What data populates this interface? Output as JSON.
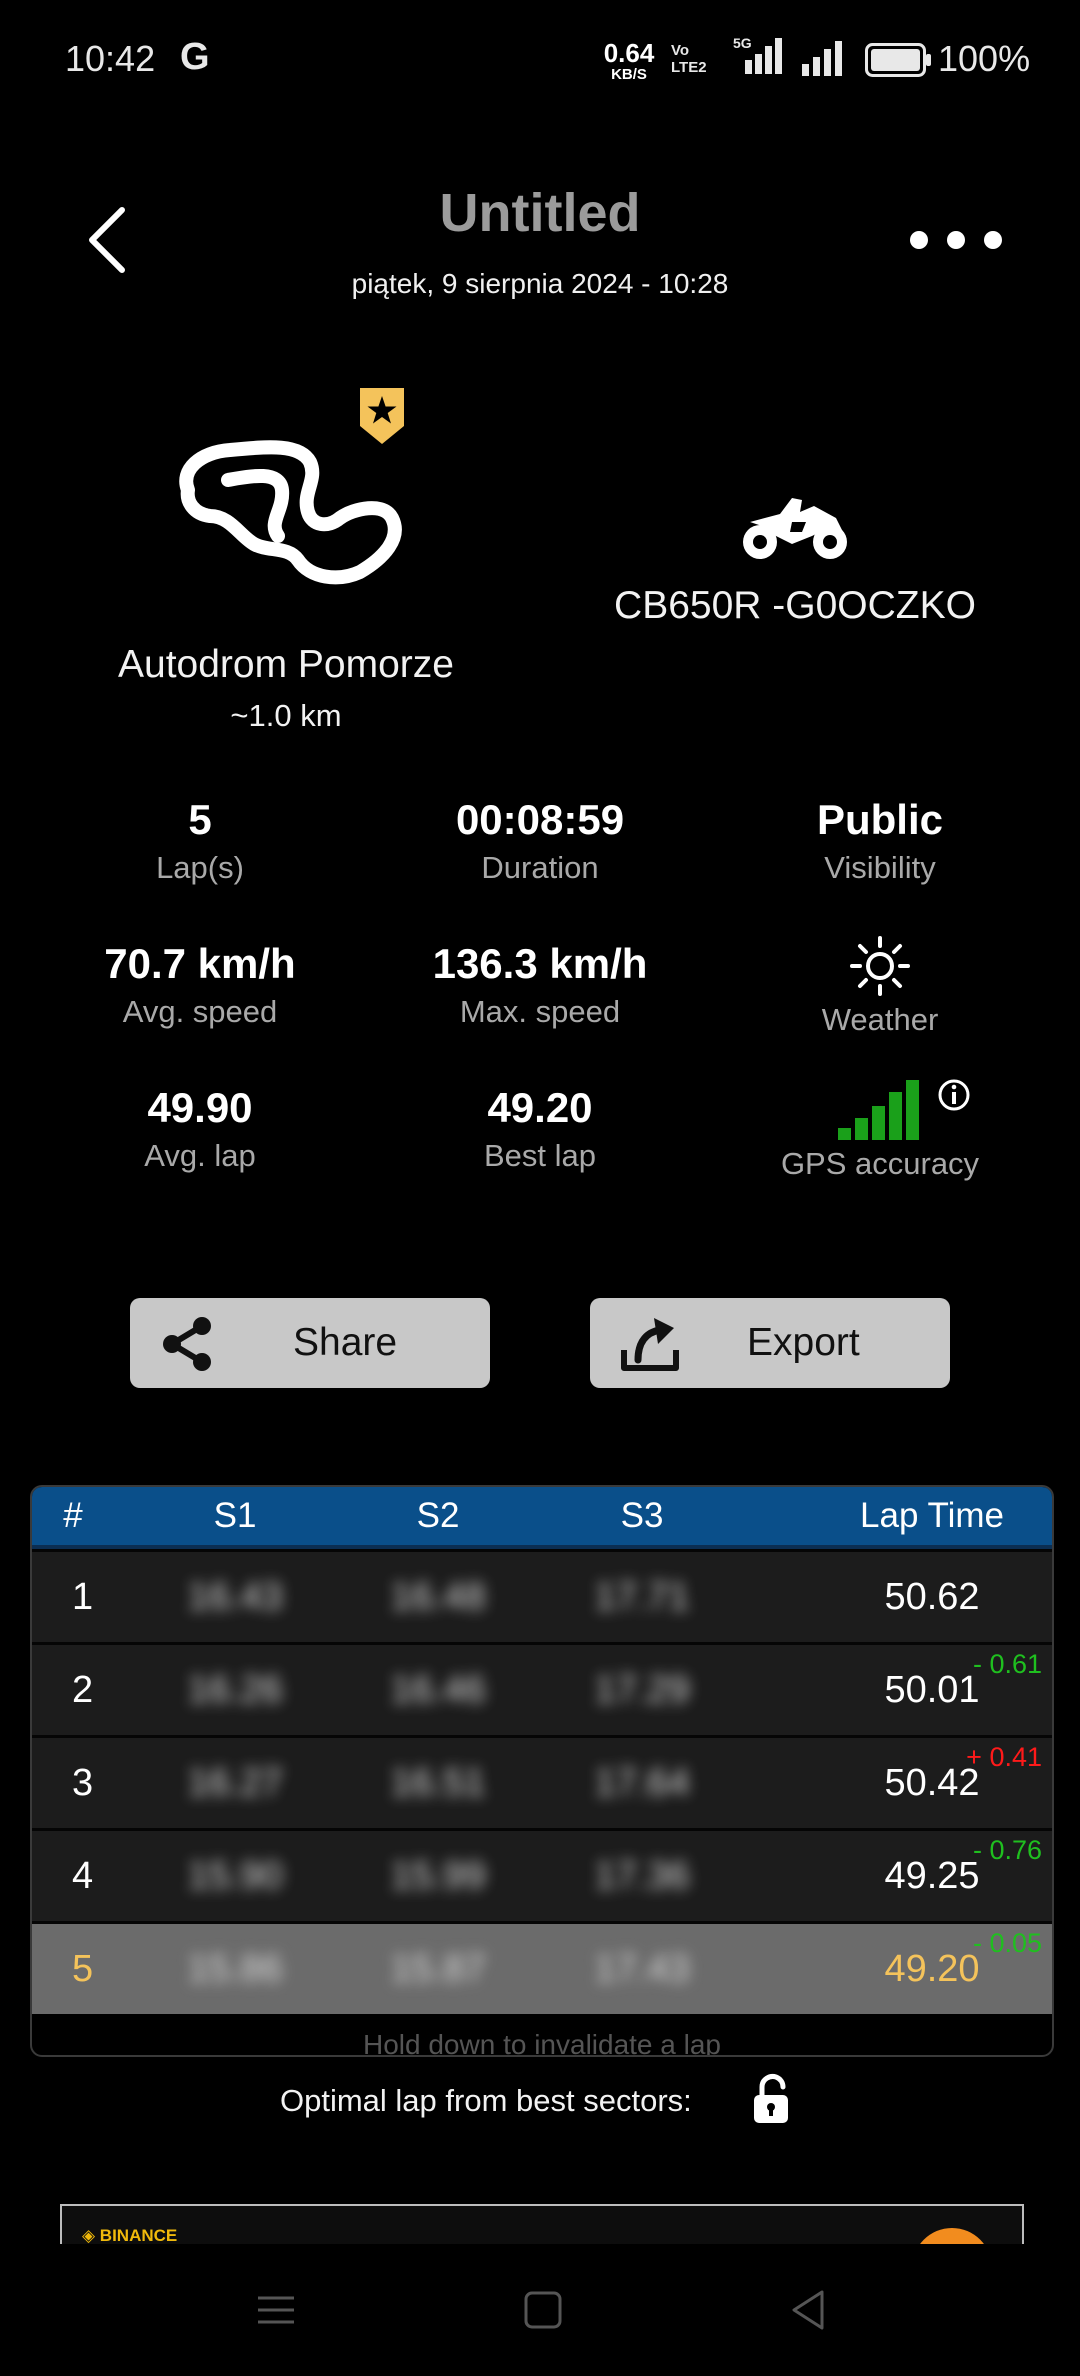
{
  "status_bar": {
    "time": "10:42",
    "g_logo": "G",
    "speed_value": "0.64",
    "speed_unit": "KB/S",
    "volte": "Vo LTE2",
    "network": "5G",
    "battery": "100%"
  },
  "header": {
    "title": "Untitled",
    "subtitle": "piątek, 9 sierpnia 2024  -  10:28"
  },
  "track": {
    "name": "Autodrom Pomorze",
    "length": "~1.0 km",
    "badge_icon": "star-badge-icon"
  },
  "bike": {
    "name": "CB650R -G0OCZKO",
    "icon": "motorcycle-icon"
  },
  "stats": {
    "laps": {
      "value": "5",
      "label": "Lap(s)"
    },
    "duration": {
      "value": "00:08:59",
      "label": "Duration"
    },
    "visibility": {
      "value": "Public",
      "label": "Visibility"
    },
    "avg_speed": {
      "value": "70.7 km/h",
      "label": "Avg. speed"
    },
    "max_speed": {
      "value": "136.3 km/h",
      "label": "Max. speed"
    },
    "weather": {
      "label": "Weather",
      "icon": "sun-icon"
    },
    "avg_lap": {
      "value": "49.90",
      "label": "Avg. lap"
    },
    "best_lap": {
      "value": "49.20",
      "label": "Best lap"
    },
    "gps": {
      "label": "GPS accuracy",
      "bars": 5
    }
  },
  "buttons": {
    "share": "Share",
    "export": "Export"
  },
  "laps_table": {
    "headers": [
      "#",
      "S1",
      "S2",
      "S3",
      "Lap Time"
    ],
    "rows": [
      {
        "n": "1",
        "s1": "16.43",
        "s2": "16.48",
        "s3": "17.71",
        "lap": "50.62",
        "delta": ""
      },
      {
        "n": "2",
        "s1": "16.26",
        "s2": "16.46",
        "s3": "17.29",
        "lap": "50.01",
        "delta": "- 0.61"
      },
      {
        "n": "3",
        "s1": "16.27",
        "s2": "16.51",
        "s3": "17.64",
        "lap": "50.42",
        "delta": "+ 0.41"
      },
      {
        "n": "4",
        "s1": "15.90",
        "s2": "15.99",
        "s3": "17.36",
        "lap": "49.25",
        "delta": "- 0.76"
      },
      {
        "n": "5",
        "s1": "15.86",
        "s2": "15.87",
        "s3": "17.43",
        "lap": "49.20",
        "delta": "- 0.05"
      }
    ],
    "hint": "Hold down to invalidate a lap"
  },
  "optimal": {
    "label": "Optimal lap from best sectors:"
  },
  "ad": {
    "brand": "BINANCE"
  },
  "colors": {
    "background": "#000000",
    "table_header": "#0a4f8a",
    "best_lap": "#f4c35b",
    "badge": "#f4c35b",
    "gps_green": "#1aa01a",
    "delta_negative": "#1fbf1f",
    "delta_positive": "#ff1a1a"
  }
}
